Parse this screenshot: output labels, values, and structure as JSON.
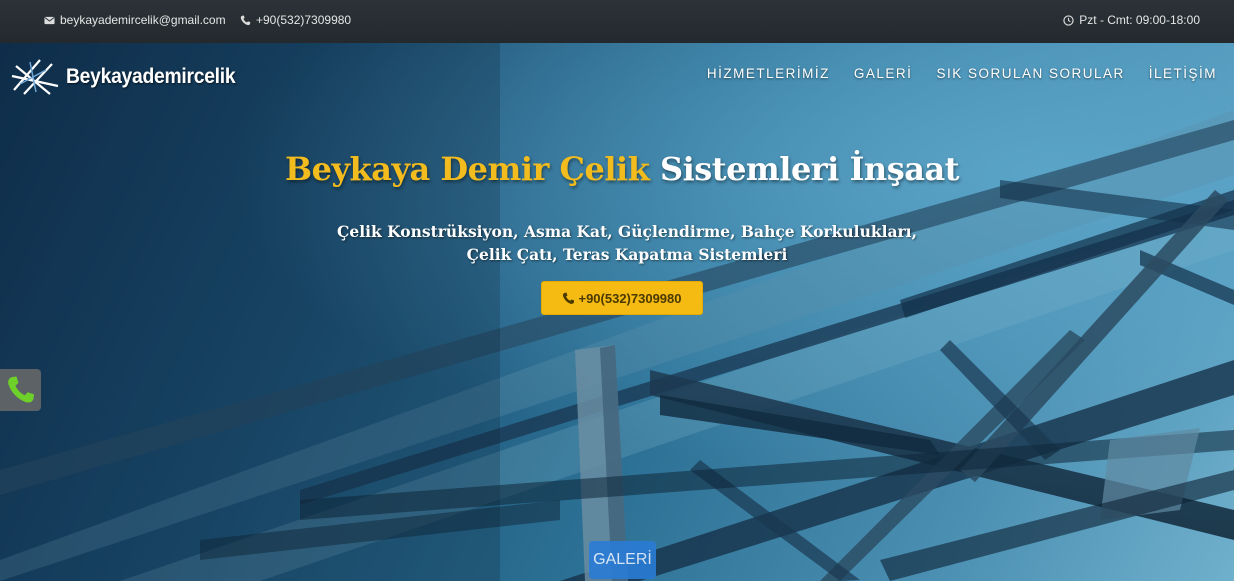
{
  "topbar": {
    "email": "beykayademircelik@gmail.com",
    "phone": "+90(532)7309980",
    "hours": "Pzt - Cmt: 09:00-18:00",
    "icons": {
      "email": "envelope-icon",
      "phone": "phone-icon",
      "hours": "clock-icon"
    }
  },
  "brand": {
    "logo_text": "Beykayademircelik",
    "logo_icon": "steel-beam-logo-icon"
  },
  "nav": {
    "items": [
      {
        "label": "HİZMETLERİMİZ"
      },
      {
        "label": "GALERİ"
      },
      {
        "label": "SIK SORULAN SORULAR"
      },
      {
        "label": "İLETİŞİM"
      }
    ]
  },
  "hero": {
    "title_highlight": "Beykaya Demir Çelik",
    "title_rest": "Sistemleri İnşaat",
    "subtitle_line1": "Çelik Konstrüksiyon, Asma Kat, Güçlendirme, Bahçe Korkulukları,",
    "subtitle_line2": "Çelik Çatı, Teras Kapatma Sistemleri",
    "cta_label": "+90(532)7309980"
  },
  "floating": {
    "call_icon": "phone-call-icon",
    "galeri_label": "GALERİ"
  },
  "colors": {
    "accent_gold": "#f5bb13",
    "title_gold": "#f2bb1e",
    "topbar": "#2c3338",
    "call_green": "#6ed12a",
    "galeri_blue": "#2a7cd6"
  }
}
